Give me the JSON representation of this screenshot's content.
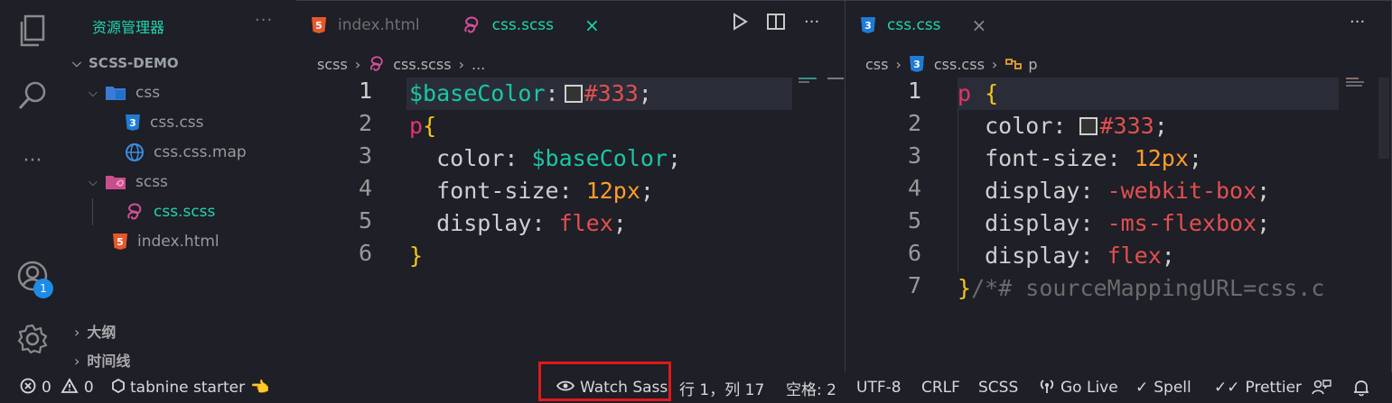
{
  "explorer": {
    "title": "资源管理器",
    "more": "···",
    "project": "SCSS-DEMO",
    "tree": [
      {
        "label": "css"
      },
      {
        "label": "css.css"
      },
      {
        "label": "css.css.map"
      },
      {
        "label": "scss"
      },
      {
        "label": "css.scss"
      },
      {
        "label": "index.html"
      }
    ],
    "outline": "大纲",
    "timeline": "时间线"
  },
  "activity": {
    "badge_count": "1"
  },
  "editor_left": {
    "tabs": [
      {
        "label": "index.html"
      },
      {
        "label": "css.scss",
        "close": "×"
      }
    ],
    "breadcrumb": {
      "folder": "scss",
      "file": "css.scss",
      "rest": "..."
    },
    "line_numbers": [
      "1",
      "2",
      "3",
      "4",
      "5",
      "6"
    ],
    "code": {
      "l1_var": "$baseColor",
      "l1_colon": ":",
      "l1_val": "#333",
      "l1_end": ";",
      "l2_sel": "p",
      "l2_brace": "{",
      "l3_prop": "color: ",
      "l3_val": "$baseColor",
      "l3_end": ";",
      "l4_prop": "font-size: ",
      "l4_val": "12px",
      "l4_end": ";",
      "l5_prop": "display: ",
      "l5_val": "flex",
      "l5_end": ";",
      "l6_brace": "}"
    }
  },
  "editor_right": {
    "tabs": [
      {
        "label": "css.css",
        "close": "×"
      }
    ],
    "breadcrumb": {
      "folder": "css",
      "file": "css.css",
      "symbol": "p"
    },
    "line_numbers": [
      "1",
      "2",
      "3",
      "4",
      "5",
      "6",
      "7"
    ],
    "code": {
      "l1_sel": "p",
      "l1_brace": "{",
      "l2_prop": "color: ",
      "l2_val": "#333",
      "l2_end": ";",
      "l3_prop": "font-size: ",
      "l3_val": "12px",
      "l3_end": ";",
      "l4_prop": "display: ",
      "l4_val": "-webkit-box",
      "l4_end": ";",
      "l5_prop": "display: ",
      "l5_val": "-ms-flexbox",
      "l5_end": ";",
      "l6_prop": "display: ",
      "l6_val": "flex",
      "l6_end": ";",
      "l7_brace": "}",
      "l7_comment": "/*# sourceMappingURL=css.c"
    }
  },
  "statusbar": {
    "errors": "0",
    "warnings": "0",
    "tabnine": "tabnine starter",
    "watch_sass": "Watch Sass",
    "position": "行 1，列 17",
    "spaces": "空格: 2",
    "encoding": "UTF-8",
    "eol": "CRLF",
    "language": "SCSS",
    "go_live": "Go Live",
    "spell": "Spell",
    "prettier": "Prettier"
  },
  "colors": {
    "accent": "#1fd6ae",
    "background": "#1e1f27",
    "highlight_box": "#e0191a",
    "badge": "#1c8ce6"
  }
}
